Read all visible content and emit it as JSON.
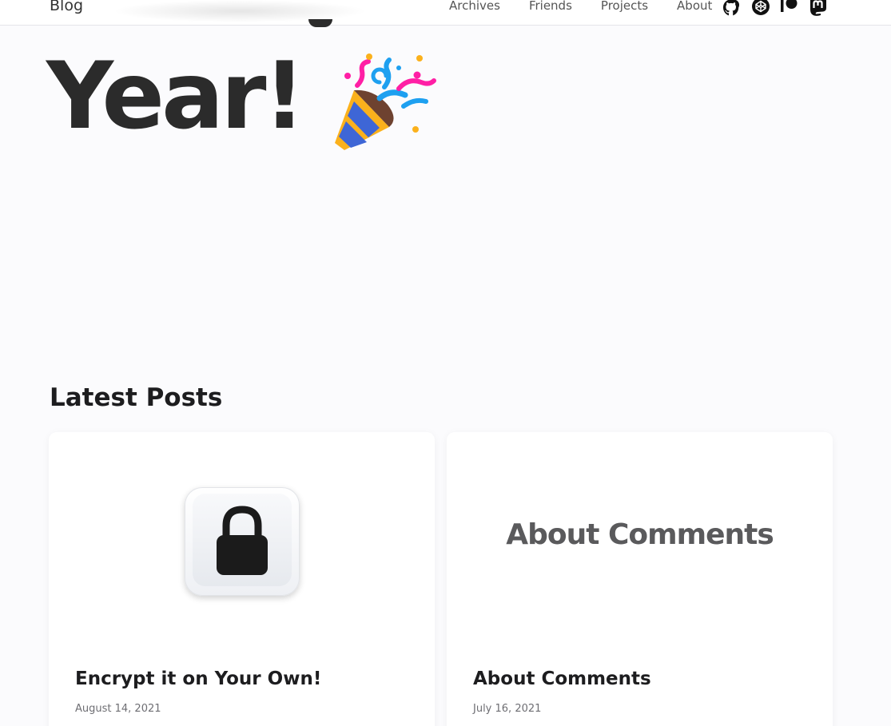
{
  "header": {
    "brand": "Blog",
    "nav": [
      "Archives",
      "Friends",
      "Projects",
      "About"
    ],
    "social_icons": [
      "github-icon",
      "codepen-icon",
      "patreon-icon",
      "mastodon-icon"
    ]
  },
  "hero": {
    "title": "Year!",
    "emoji_icon": "party-popper-icon"
  },
  "latest": {
    "heading": "Latest Posts",
    "posts": [
      {
        "title": "Encrypt it on Your Own!",
        "date": "August 14, 2021",
        "cover_icon": "lock-icon"
      },
      {
        "title": "About Comments",
        "date": "July 16, 2021",
        "cover_text": "About Comments"
      }
    ]
  },
  "colors": {
    "background": "#fbfbfd",
    "text": "#1d1d1f",
    "muted": "#6e6e73"
  }
}
